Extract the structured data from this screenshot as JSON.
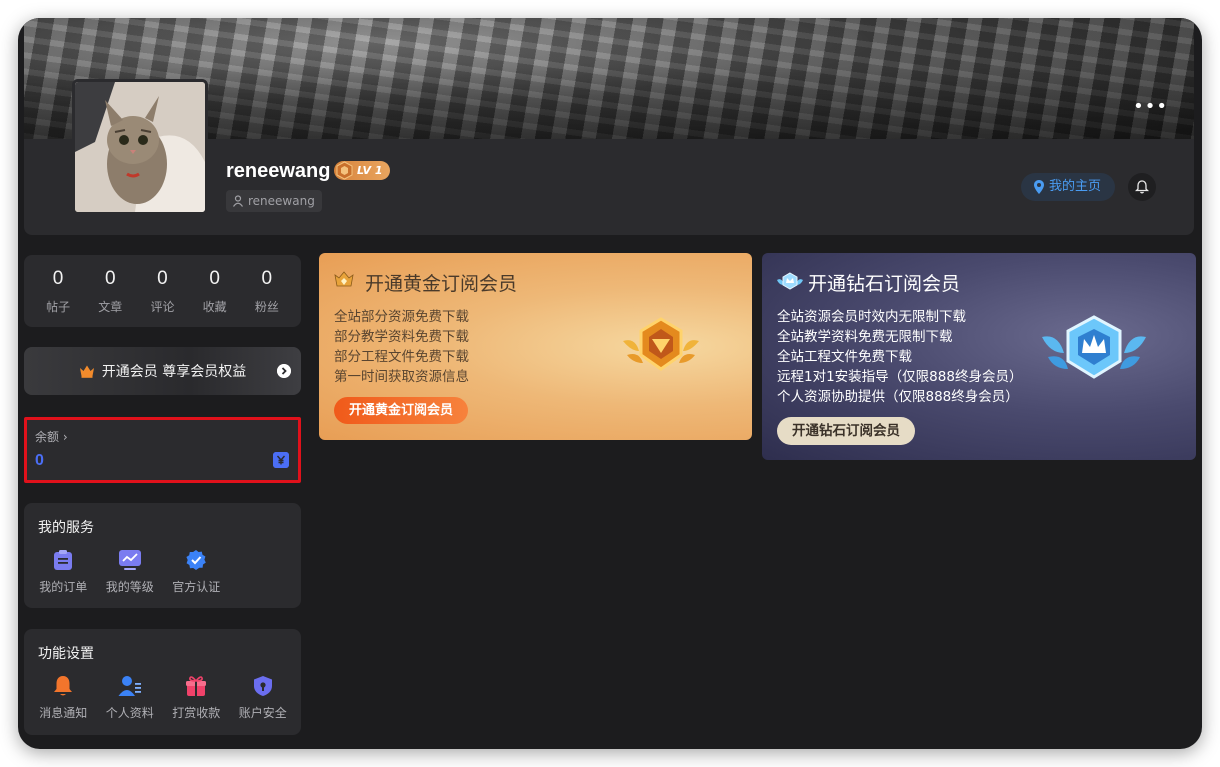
{
  "profile": {
    "name": "reneewang",
    "level": "LV 1",
    "handle": "reneewang",
    "homepage_label": "我的主页",
    "more_label": "•••"
  },
  "stats": [
    {
      "value": "0",
      "label": "帖子"
    },
    {
      "value": "0",
      "label": "文章"
    },
    {
      "value": "0",
      "label": "评论"
    },
    {
      "value": "0",
      "label": "收藏"
    },
    {
      "value": "0",
      "label": "粉丝"
    }
  ],
  "vip_banner": {
    "label": "开通会员 尊享会员权益"
  },
  "balance": {
    "label": "余额 ›",
    "value": "0"
  },
  "services": {
    "title": "我的服务",
    "items": [
      {
        "label": "我的订单",
        "icon": "clipboard-icon"
      },
      {
        "label": "我的等级",
        "icon": "chart-icon"
      },
      {
        "label": "官方认证",
        "icon": "verified-icon"
      }
    ]
  },
  "settings": {
    "title": "功能设置",
    "items": [
      {
        "label": "消息通知",
        "icon": "bell-icon"
      },
      {
        "label": "个人资料",
        "icon": "user-icon"
      },
      {
        "label": "打赏收款",
        "icon": "gift-icon"
      },
      {
        "label": "账户安全",
        "icon": "shield-icon"
      }
    ]
  },
  "gold_card": {
    "title": "开通黄金订阅会员",
    "perks": [
      "全站部分资源免费下载",
      "部分教学资料免费下载",
      "部分工程文件免费下载",
      "第一时间获取资源信息"
    ],
    "cta": "开通黄金订阅会员"
  },
  "diamond_card": {
    "title": "开通钻石订阅会员",
    "perks": [
      "全站资源会员时效内无限制下载",
      "全站教学资料免费无限制下载",
      "全站工程文件免费下载",
      "远程1对1安装指导（仅限888终身会员）",
      "个人资源协助提供（仅限888终身会员）"
    ],
    "cta": "开通钻石订阅会员"
  },
  "colors": {
    "accent_blue": "#4b6ef5",
    "link_blue": "#4a9cf2",
    "highlight_red": "#e0111b",
    "gold_cta": "#f05a1a"
  }
}
